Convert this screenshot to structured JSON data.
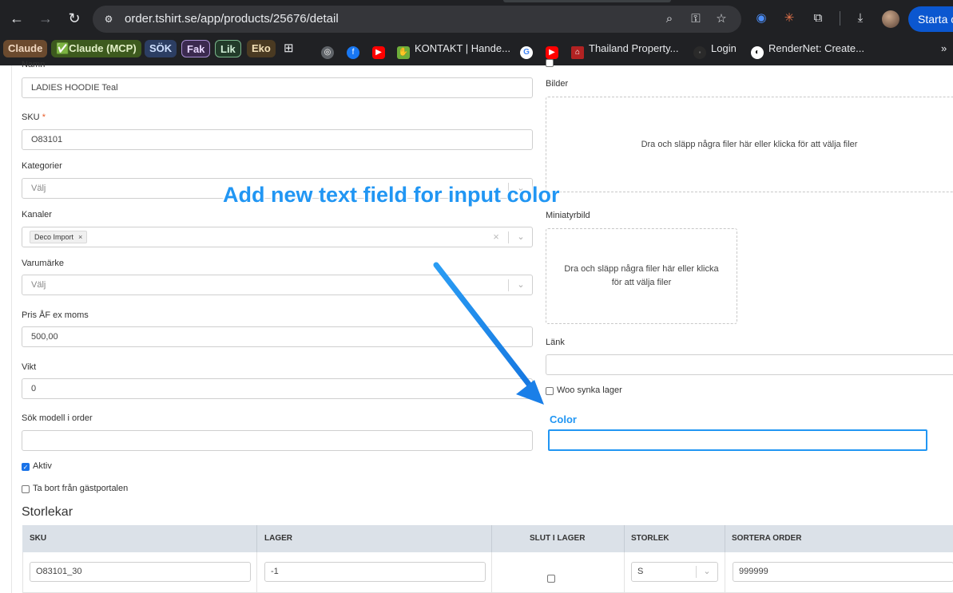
{
  "browser": {
    "url": "order.tshirt.se/app/products/25676/detail",
    "starta_label": "Starta c",
    "bookmarks": [
      {
        "label": "Claude"
      },
      {
        "label": "✅Claude (MCP)"
      },
      {
        "label": "SÖK"
      },
      {
        "label": "Fak"
      },
      {
        "label": "Lik"
      },
      {
        "label": "Eko"
      },
      {
        "label": "KONTAKT | Hande..."
      },
      {
        "label": "Thailand Property..."
      },
      {
        "label": "Login"
      },
      {
        "label": "RenderNet: Create..."
      }
    ],
    "more_label": "»"
  },
  "form": {
    "name_label": "Namn",
    "name_value": "LADIES HOODIE Teal",
    "sku_label": "SKU",
    "sku_required": "*",
    "sku_value": "O83101",
    "categories_label": "Kategorier",
    "categories_placeholder": "Välj",
    "channels_label": "Kanaler",
    "channels_tag": "Deco Import",
    "brand_label": "Varumärke",
    "brand_placeholder": "Välj",
    "price_label": "Pris ÅF ex moms",
    "price_value": "500,00",
    "weight_label": "Vikt",
    "weight_value": "0",
    "search_model_label": "Sök modell i order",
    "search_model_value": "",
    "active_label": "Aktiv",
    "active_checked": true,
    "remove_guest_label": "Ta bort från gästportalen",
    "remove_guest_checked": false
  },
  "media": {
    "images_label": "Bilder",
    "images_dropzone": "Dra och släpp några filer här eller klicka för att välja filer",
    "thumbnail_label": "Miniatyrbild",
    "thumbnail_dropzone": "Dra och släpp några filer här eller klicka för att välja filer",
    "link_label": "Länk",
    "link_value": "",
    "woo_sync_label": "Woo synka lager",
    "woo_sync_checked": false
  },
  "mockup": {
    "annotation": "Add new text field for input color",
    "color_label": "Color",
    "color_value": "",
    "accent_color": "#2196f3"
  },
  "sizes": {
    "title": "Storlekar",
    "columns": [
      "SKU",
      "LAGER",
      "SLUT I LAGER",
      "STORLEK",
      "SORTERA ORDER"
    ],
    "rows": [
      {
        "sku": "O83101_30",
        "stock": "-1",
        "out_of_stock": false,
        "size": "S",
        "sort_order": "999999"
      }
    ]
  }
}
